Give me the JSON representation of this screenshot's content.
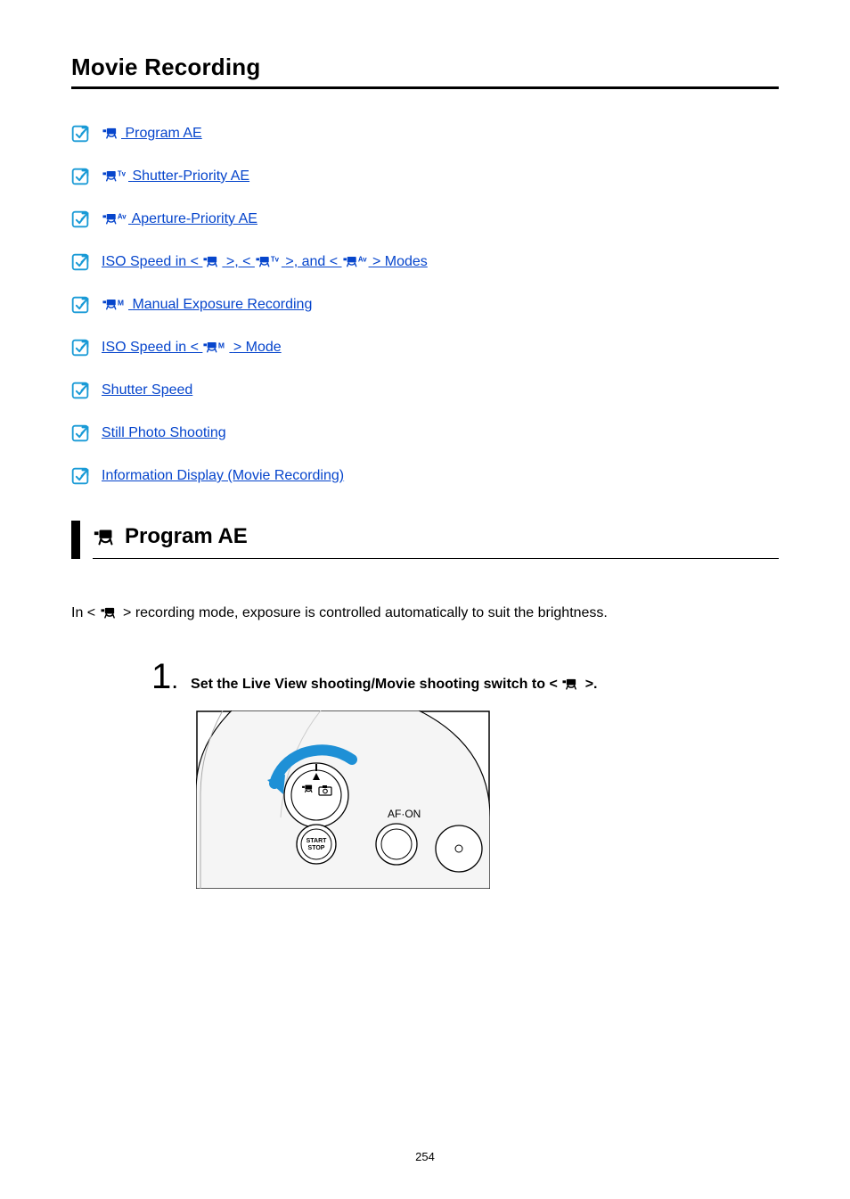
{
  "page_title": "Movie Recording",
  "toc": [
    {
      "id": "program-ae",
      "label_plain": "Program AE",
      "mode": "movie",
      "has_prefix_icon": true
    },
    {
      "id": "shutter-priority-ae",
      "label_plain": "Shutter-Priority AE",
      "mode": "movieTv",
      "has_prefix_icon": true
    },
    {
      "id": "aperture-priority-ae",
      "label_plain": "Aperture-Priority AE",
      "mode": "movieAv",
      "has_prefix_icon": true
    },
    {
      "id": "iso-speed-modes",
      "parts": {
        "a": "ISO Speed in < ",
        "b": " >, < ",
        "c": " >, and < ",
        "d": " > Modes"
      },
      "mode_sequence": [
        "movie",
        "movieTv",
        "movieAv"
      ],
      "has_prefix_icon": false
    },
    {
      "id": "manual-exposure",
      "label_plain": "Manual Exposure Recording",
      "mode": "movieM",
      "has_prefix_icon": true
    },
    {
      "id": "iso-speed-m",
      "parts": {
        "a": "ISO Speed in < ",
        "b": " > Mode"
      },
      "mode_sequence": [
        "movieM"
      ],
      "has_prefix_icon": false
    },
    {
      "id": "shutter-speed",
      "label_plain": "Shutter Speed",
      "has_prefix_icon": false
    },
    {
      "id": "still-photo-shooting",
      "label_plain": "Still Photo Shooting",
      "has_prefix_icon": false
    },
    {
      "id": "info-display",
      "label_plain": "Information Display (Movie Recording)",
      "has_prefix_icon": false
    }
  ],
  "section": {
    "id": "program-ae-section",
    "title": "Program AE",
    "mode": "movie"
  },
  "intro": {
    "a": "In < ",
    "b": " > recording mode, exposure is controlled automatically to suit the brightness."
  },
  "step": {
    "num": "1",
    "text_a": "Set the Live View shooting/Movie shooting switch to < ",
    "text_b": " >."
  },
  "figure": {
    "labels": {
      "afon": "AF·ON",
      "startstop_top": "START",
      "startstop_bottom": "STOP"
    }
  },
  "page_number": "254",
  "colors": {
    "link": "#0645cc",
    "arrow": "#1e90d6",
    "icon": "#199ad6"
  }
}
